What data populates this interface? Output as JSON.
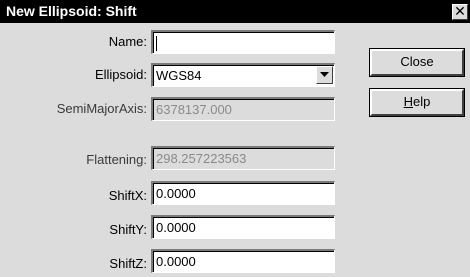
{
  "window": {
    "title": "New Ellipsoid: Shift",
    "close_glyph": "✕"
  },
  "form": {
    "name": {
      "label": "Name:",
      "value": ""
    },
    "ellipsoid": {
      "label": "Ellipsoid:",
      "value": "WGS84"
    },
    "semi_major_axis": {
      "label": "SemiMajorAxis:",
      "value": "6378137.000"
    },
    "flattening": {
      "label": "Flattening:",
      "value": "298.257223563"
    },
    "shift_x": {
      "label": "ShiftX:",
      "value": "0.0000"
    },
    "shift_y": {
      "label": "ShiftY:",
      "value": "0.0000"
    },
    "shift_z": {
      "label": "ShiftZ:",
      "value": "0.0000"
    }
  },
  "buttons": {
    "close_label": "Close",
    "help_mnemonic": "H",
    "help_rest": "elp"
  },
  "colors": {
    "titlebar": "#000000",
    "dialog_bg": "#dcdcdc",
    "disabled_text": "#8a8a8a"
  },
  "icons": {
    "dropdown": "chevron-down-icon"
  }
}
